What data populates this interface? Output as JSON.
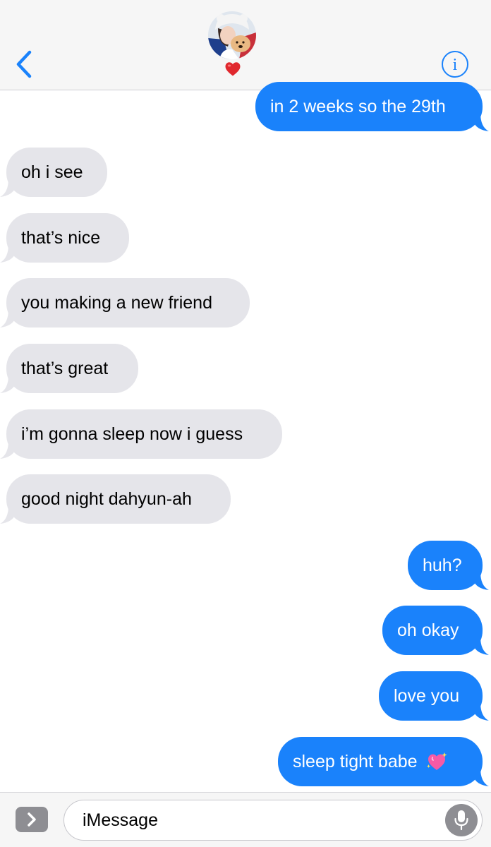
{
  "header": {
    "back_icon": "chevron-left-icon",
    "contact_avatar": "contact-avatar-photo",
    "contact_emoji": "red-heart-emoji",
    "info_icon": "info-icon",
    "info_glyph": "i"
  },
  "colors": {
    "accent": "#1a82fb",
    "received_bubble": "#e5e5ea",
    "header_bg": "#f6f6f6",
    "heart_red": "#e0282e",
    "sparkle_heart_pink": "#f75aa6"
  },
  "messages": [
    {
      "direction": "sent",
      "text": "in 2 weeks so the 29th"
    },
    {
      "direction": "received",
      "text": "oh i see"
    },
    {
      "direction": "received",
      "text": "that’s nice"
    },
    {
      "direction": "received",
      "text": "you making a new friend"
    },
    {
      "direction": "received",
      "text": "that’s great"
    },
    {
      "direction": "received",
      "text": "i’m gonna sleep now i guess"
    },
    {
      "direction": "received",
      "text": "good night dahyun-ah"
    },
    {
      "direction": "sent",
      "text": "huh?"
    },
    {
      "direction": "sent",
      "text": "oh okay"
    },
    {
      "direction": "sent",
      "text": "love you"
    },
    {
      "direction": "sent",
      "text": "sleep tight babe",
      "emoji": "sparkling-heart-emoji"
    }
  ],
  "input": {
    "expand_icon": "chevron-right-icon",
    "placeholder": "iMessage",
    "mic_icon": "microphone-icon"
  }
}
